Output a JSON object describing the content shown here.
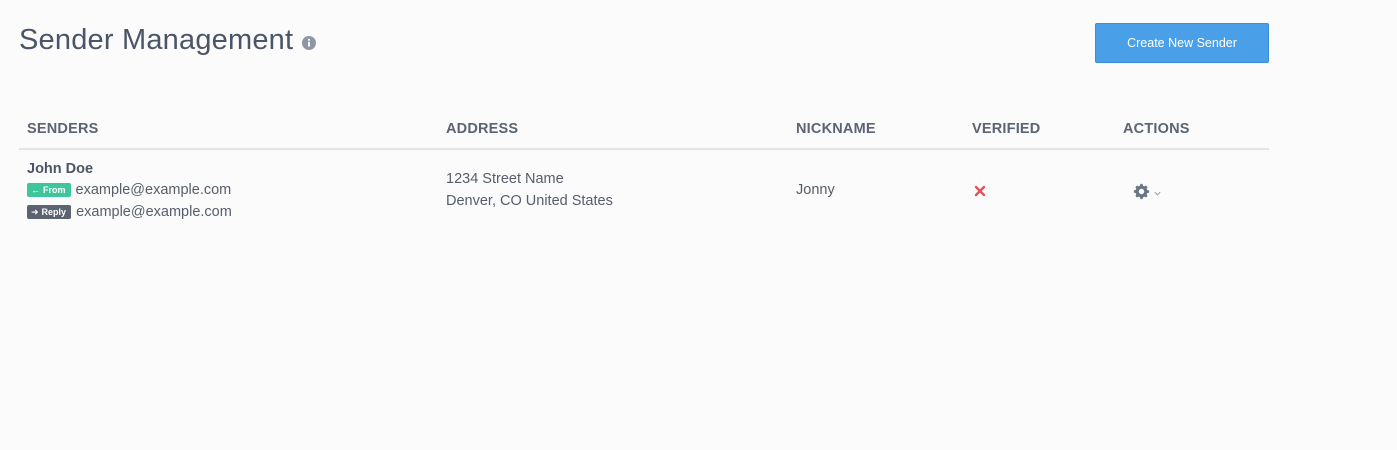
{
  "header": {
    "title": "Sender Management",
    "create_button_label": "Create New Sender"
  },
  "table": {
    "columns": [
      "SENDERS",
      "ADDRESS",
      "NICKNAME",
      "VERIFIED",
      "ACTIONS"
    ],
    "rows": [
      {
        "name": "John Doe",
        "from_badge": "From",
        "from_email": "example@example.com",
        "reply_badge": "Reply",
        "reply_email": "example@example.com",
        "address_line1": "1234 Street Name",
        "address_line2": "Denver, CO United States",
        "nickname": "Jonny",
        "verified": false
      }
    ]
  },
  "colors": {
    "primary_button": "#4aa0e8",
    "from_badge": "#3fc59b",
    "reply_badge": "#5b6270",
    "not_verified_icon": "#e0535a"
  },
  "icons": {
    "title_info": "info-icon",
    "verified_status": "x-mark-icon",
    "actions_menu": "gear-icon",
    "actions_caret": "chevron-down-icon"
  }
}
